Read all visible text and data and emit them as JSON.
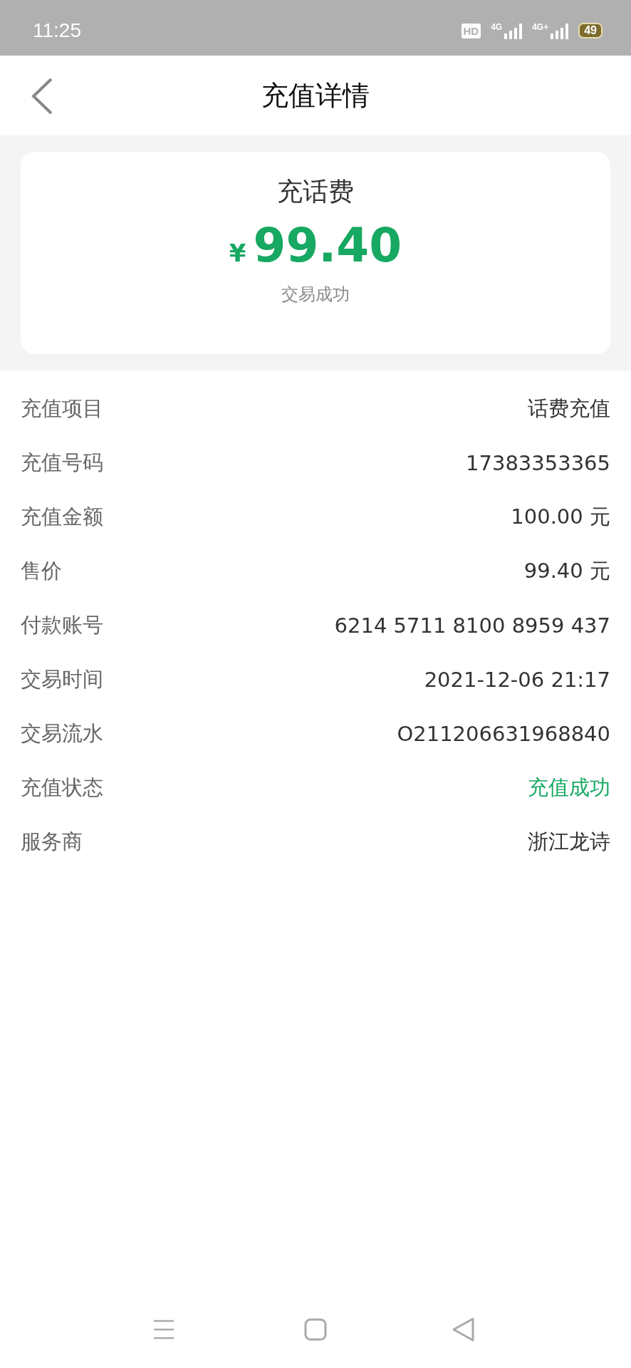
{
  "status_bar": {
    "time": "11:25",
    "hd_label": "HD",
    "networks": [
      "4G",
      "4G+"
    ],
    "battery": "49"
  },
  "header": {
    "title": "充值详情"
  },
  "summary": {
    "title": "充话费",
    "currency": "¥",
    "amount": "99.40",
    "status": "交易成功"
  },
  "details": [
    {
      "label": "充值项目",
      "value": "话费充值",
      "kind": "plain"
    },
    {
      "label": "充值号码",
      "value": "17383353365",
      "kind": "plain"
    },
    {
      "label": "充值金额",
      "value": "100.00 元",
      "kind": "plain"
    },
    {
      "label": "售价",
      "value": "99.40 元",
      "kind": "plain"
    },
    {
      "label": "付款账号",
      "value": "6214 5711 8100 8959 437",
      "kind": "plain"
    },
    {
      "label": "交易时间",
      "value": "2021-12-06 21:17",
      "kind": "plain"
    },
    {
      "label": "交易流水",
      "value": "O211206631968840",
      "kind": "plain"
    },
    {
      "label": "充值状态",
      "value": "充值成功",
      "kind": "success"
    },
    {
      "label": "服务商",
      "value": "浙江龙诗",
      "kind": "plain"
    }
  ]
}
